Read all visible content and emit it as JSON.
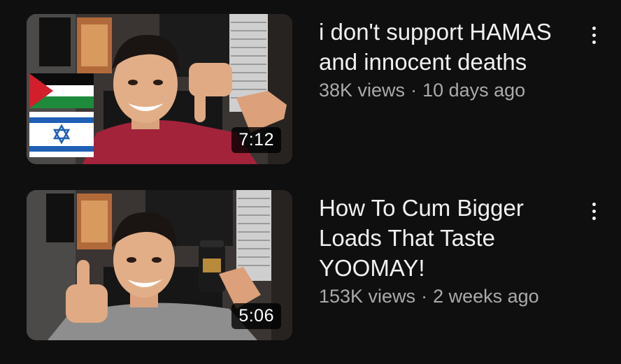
{
  "videos": [
    {
      "title": "i don't support HAMAS and innocent deaths",
      "views": "38K views",
      "separator": "·",
      "age": "10 days ago",
      "duration": "7:12"
    },
    {
      "title": "How To Cum Bigger Loads That Taste YOOMAY!",
      "views": "153K views",
      "separator": "·",
      "age": "2 weeks ago",
      "duration": "5:06"
    }
  ],
  "icons": {
    "menu": "more-vert-icon"
  },
  "colors": {
    "background": "#0f0f0f",
    "title": "#f1f1f1",
    "meta": "#aaaaaa"
  }
}
